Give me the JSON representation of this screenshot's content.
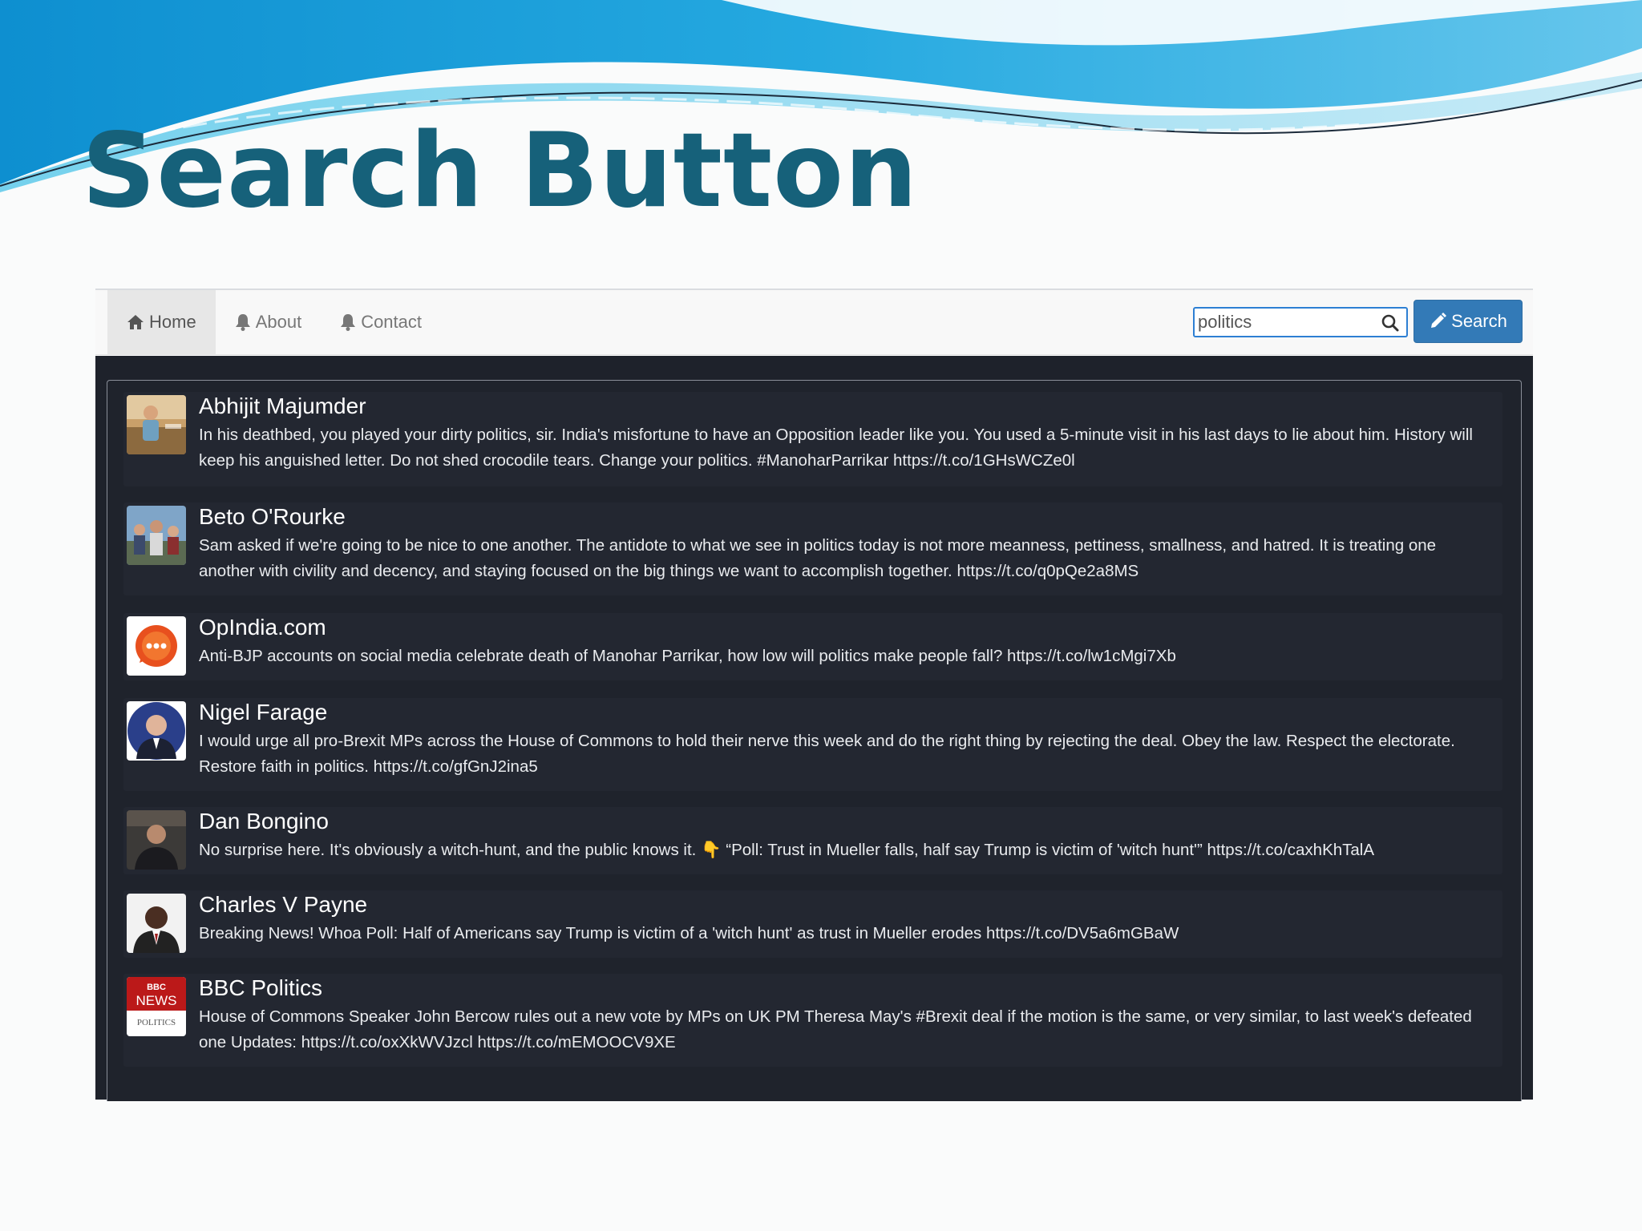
{
  "slide": {
    "title": "Search Button"
  },
  "nav": {
    "items": [
      {
        "label": "Home",
        "icon": "home-icon",
        "active": true
      },
      {
        "label": "About",
        "icon": "bell-icon",
        "active": false
      },
      {
        "label": "Contact",
        "icon": "bell-icon",
        "active": false
      }
    ]
  },
  "search": {
    "value": "politics",
    "button_label": "Search"
  },
  "tweets": [
    {
      "name": "Abhijit Majumder",
      "text": "In his deathbed, you played your dirty politics, sir. India's misfortune to have an Opposition leader like you. You used a 5-minute visit in his last days to lie about him. History will keep his anguished letter. Do not shed crocodile tears. Change your politics. #ManoharParrikar https://t.co/1GHsWCZe0l",
      "avatar": "profile-photo-avatar"
    },
    {
      "name": "Beto O'Rourke",
      "text": "Sam asked if we're going to be nice to one another. The antidote to what we see in politics today is not more meanness, pettiness, smallness, and hatred. It is treating one another with civility and decency, and staying focused on the big things we want to accomplish together. https://t.co/q0pQe2a8MS",
      "avatar": "group-photo-avatar"
    },
    {
      "name": "OpIndia.com",
      "text": "Anti-BJP accounts on social media celebrate death of Manohar Parrikar, how low will politics make people fall? https://t.co/lw1cMgi7Xb",
      "avatar": "opindia-logo-avatar"
    },
    {
      "name": "Nigel Farage",
      "text": "I would urge all pro-Brexit MPs across the House of Commons to hold their nerve this week and do the right thing by rejecting the deal. Obey the law. Respect the electorate. Restore faith in politics. https://t.co/gfGnJ2ina5",
      "avatar": "portrait-avatar"
    },
    {
      "name": "Dan Bongino",
      "text": "No surprise here. It's obviously a witch-hunt, and the public knows it. 👇 “Poll: Trust in Mueller falls, half say Trump is victim of 'witch hunt'” https://t.co/caxhKhTalA",
      "avatar": "portrait-avatar"
    },
    {
      "name": "Charles V Payne",
      "text": "Breaking News! Whoa Poll: Half of Americans say Trump is victim of a 'witch hunt' as trust in Mueller erodes https://t.co/DV5a6mGBaW",
      "avatar": "portrait-avatar"
    },
    {
      "name": "BBC Politics",
      "text": "House of Commons Speaker John Bercow rules out a new vote by MPs on UK PM Theresa May's #Brexit deal if the motion is the same, or very similar, to last week's defeated one Updates: https://t.co/oxXkWVJzcl https://t.co/mEMOOCV9XE",
      "avatar": "bbc-news-logo-avatar",
      "logo_text": [
        "BBC",
        "NEWS",
        "POLITICS"
      ]
    }
  ],
  "colors": {
    "title": "#16617a",
    "wave": "#1a9fd6",
    "button": "#337ab7",
    "content_bg": "#1e222b"
  }
}
